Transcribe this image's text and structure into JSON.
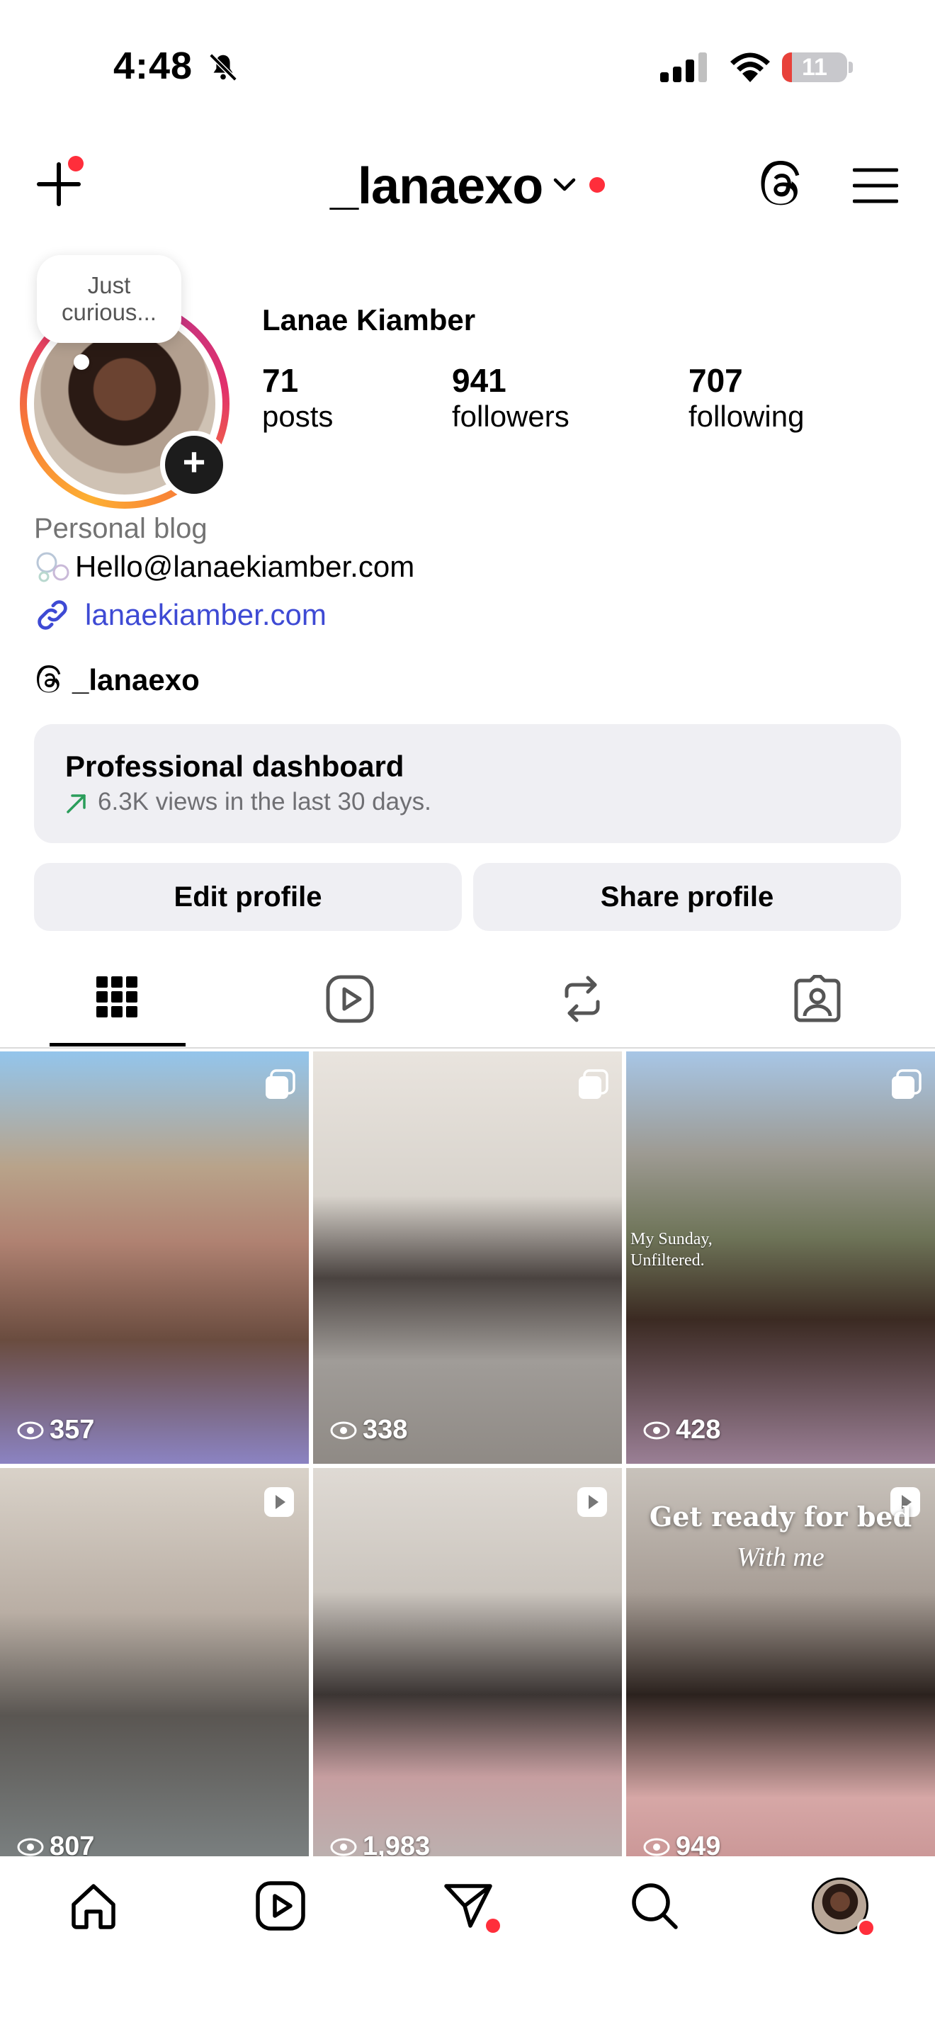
{
  "status_bar": {
    "time": "4:48",
    "battery": "11"
  },
  "header": {
    "username": "_lanaexo"
  },
  "note": {
    "text_line1": "Just",
    "text_line2": "curious..."
  },
  "profile": {
    "full_name": "Lanae Kiamber",
    "stats": [
      {
        "value": "71",
        "label": "posts"
      },
      {
        "value": "941",
        "label": "followers"
      },
      {
        "value": "707",
        "label": "following"
      }
    ],
    "category": "Personal blog",
    "email": "Hello@lanaekiamber.com",
    "link": "lanaekiamber.com",
    "threads_handle": "_lanaexo"
  },
  "dashboard": {
    "title": "Professional dashboard",
    "subtitle": "6.3K views in the last 30 days."
  },
  "buttons": {
    "edit": "Edit profile",
    "share": "Share profile"
  },
  "tabs": [
    "grid-icon",
    "reels-icon",
    "reposts-icon",
    "tagged-icon"
  ],
  "posts": [
    {
      "views": "357",
      "type": "carousel"
    },
    {
      "views": "338",
      "type": "carousel"
    },
    {
      "views": "428",
      "type": "carousel",
      "overlay": "My Sunday,\nUnfiltered."
    },
    {
      "views": "807",
      "type": "reel"
    },
    {
      "views": "1,983",
      "type": "reel"
    },
    {
      "views": "949",
      "type": "reel",
      "overlay": "Get ready for bed",
      "overlay2": "With me"
    }
  ],
  "post_overlays": {
    "p3": "My Sunday,",
    "p3b": "Unfiltered.",
    "p6": "Get ready for bed",
    "p6b": "With me"
  },
  "nav": [
    "home-icon",
    "reels-icon",
    "messages-icon",
    "search-icon",
    "profile-avatar"
  ],
  "colors": {
    "link": "#3e4ad4",
    "notification": "#ff2e3b",
    "panel": "#efeff3"
  }
}
